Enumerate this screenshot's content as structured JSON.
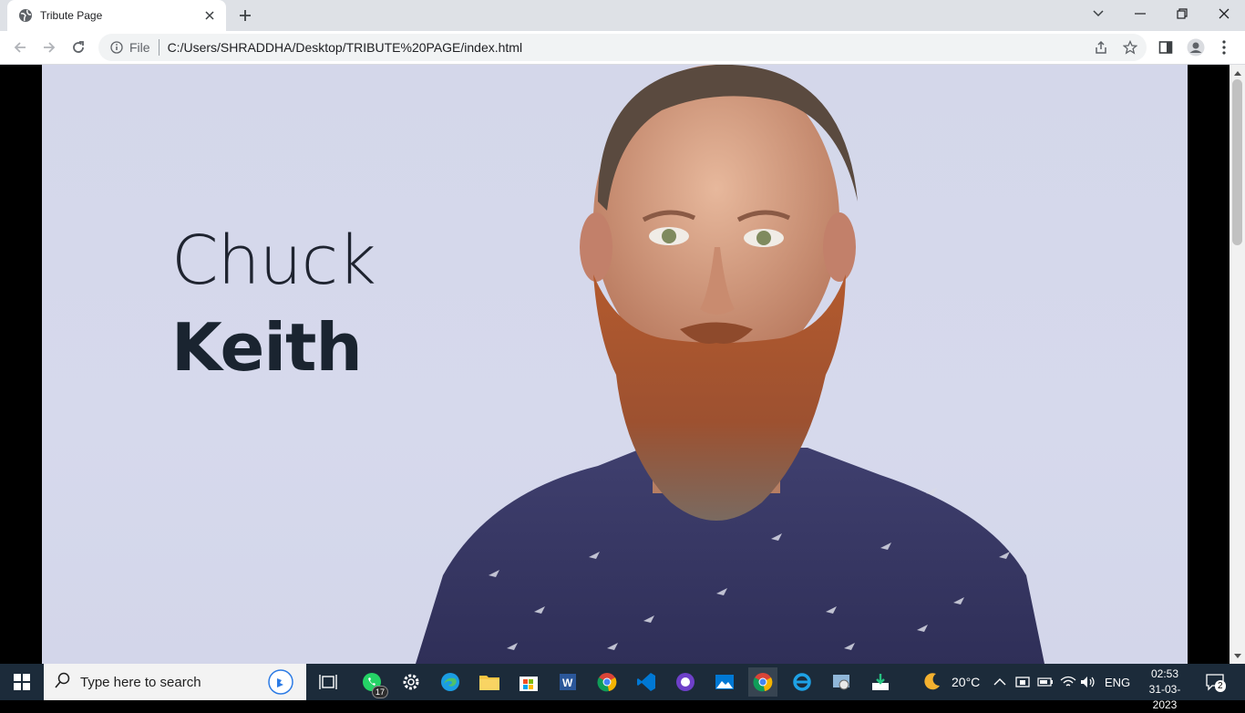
{
  "browser": {
    "tab_title": "Tribute Page",
    "omnibox_file_label": "File",
    "url": "C:/Users/SHRADDHA/Desktop/TRIBUTE%20PAGE/index.html"
  },
  "page": {
    "first_name": "Chuck",
    "last_name": "Keith"
  },
  "taskbar": {
    "search_placeholder": "Type here to search",
    "whatsapp_badge": "17",
    "weather": "20°C",
    "language": "ENG",
    "time": "02:53",
    "date": "31-03-2023",
    "notifications_count": "2"
  },
  "colors": {
    "hero_bg": "#d4d7ea",
    "name_text": "#1f2430",
    "taskbar_bg": "#1c2b3a"
  }
}
